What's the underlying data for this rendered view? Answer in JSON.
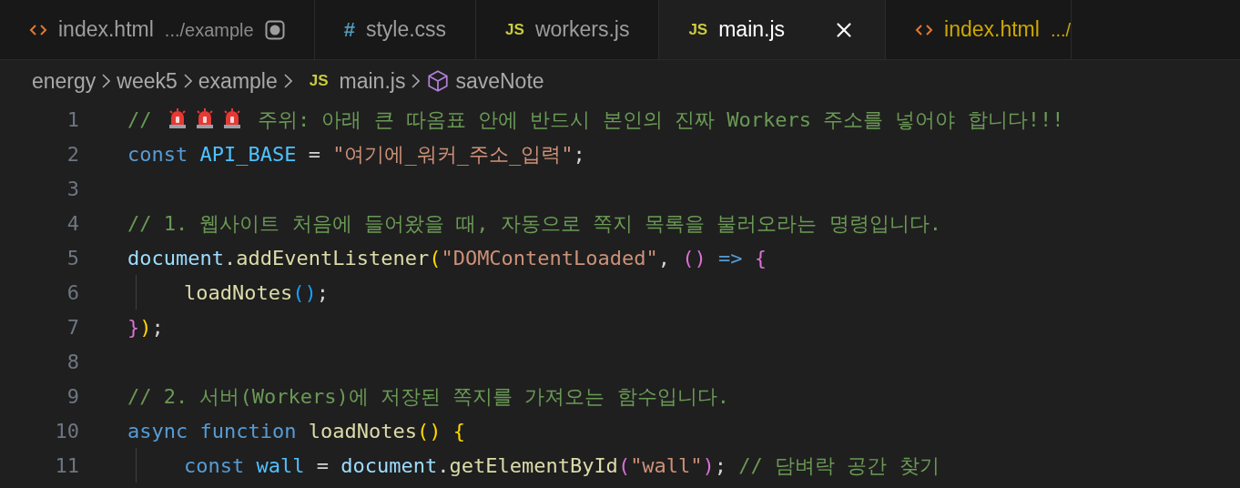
{
  "tabs": [
    {
      "icon": {
        "kind": "html"
      },
      "label": "index.html",
      "path": ".../example",
      "selected": false,
      "dirty": true,
      "warning": false
    },
    {
      "icon": {
        "kind": "css",
        "glyph": "#"
      },
      "label": "style.css",
      "selected": false,
      "dirty": false,
      "warning": false
    },
    {
      "icon": {
        "kind": "js",
        "glyph": "JS"
      },
      "label": "workers.js",
      "selected": false,
      "dirty": false,
      "warning": false
    },
    {
      "icon": {
        "kind": "js",
        "glyph": "JS"
      },
      "label": "main.js",
      "selected": true,
      "dirty": false,
      "warning": false
    },
    {
      "icon": {
        "kind": "html"
      },
      "label": "index.html",
      "path": ".../",
      "selected": false,
      "dirty": false,
      "warning": true
    }
  ],
  "breadcrumb": [
    {
      "kind": "folder",
      "label": "energy"
    },
    {
      "kind": "folder",
      "label": "week5"
    },
    {
      "kind": "folder",
      "label": "example"
    },
    {
      "kind": "file",
      "glyph": "JS",
      "label": "main.js"
    },
    {
      "kind": "symbol",
      "label": "saveNote"
    }
  ],
  "lines": [
    {
      "number": "1",
      "indent": false,
      "tokens": [
        {
          "kind": "comment",
          "text": "// "
        },
        {
          "kind": "siren"
        },
        {
          "kind": "siren"
        },
        {
          "kind": "siren"
        },
        {
          "kind": "comment",
          "text": " 주위: 아래 큰 따옴표 안에 반드시 본인의 진짜 Workers 주소를 넣어야 합니다!!!"
        }
      ]
    },
    {
      "number": "2",
      "indent": false,
      "tokens": [
        {
          "kind": "keyword",
          "text": "const "
        },
        {
          "kind": "constant",
          "text": "API_BASE"
        },
        {
          "kind": "plain",
          "text": " = "
        },
        {
          "kind": "string",
          "text": "\"여기에_워커_주소_입력\""
        },
        {
          "kind": "plain",
          "text": ";"
        }
      ]
    },
    {
      "number": "3",
      "indent": false
    },
    {
      "number": "4",
      "indent": false,
      "tokens": [
        {
          "kind": "comment",
          "text": "// 1. 웹사이트 처음에 들어왔을 때, 자동으로 쪽지 목록을 불러오라는 명령입니다."
        }
      ]
    },
    {
      "number": "5",
      "indent": false,
      "tokens": [
        {
          "kind": "variable",
          "text": "document"
        },
        {
          "kind": "plain",
          "text": "."
        },
        {
          "kind": "function",
          "text": "addEventListener"
        },
        {
          "kind": "bracket1",
          "text": "("
        },
        {
          "kind": "string",
          "text": "\"DOMContentLoaded\""
        },
        {
          "kind": "plain",
          "text": ", "
        },
        {
          "kind": "bracket2",
          "text": "() "
        },
        {
          "kind": "keyword",
          "text": "=> "
        },
        {
          "kind": "bracket2",
          "text": "{"
        }
      ]
    },
    {
      "number": "6",
      "indent": true,
      "tokens": [
        {
          "kind": "function",
          "text": "loadNotes"
        },
        {
          "kind": "bracket3",
          "text": "()"
        },
        {
          "kind": "plain",
          "text": ";"
        }
      ]
    },
    {
      "number": "7",
      "indent": false,
      "tokens": [
        {
          "kind": "bracket2",
          "text": "}"
        },
        {
          "kind": "bracket1",
          "text": ")"
        },
        {
          "kind": "plain",
          "text": ";"
        }
      ]
    },
    {
      "number": "8",
      "indent": false
    },
    {
      "number": "9",
      "indent": false,
      "tokens": [
        {
          "kind": "comment",
          "text": "// 2. 서버(Workers)에 저장된 쪽지를 가져오는 함수입니다."
        }
      ]
    },
    {
      "number": "10",
      "indent": false,
      "tokens": [
        {
          "kind": "keyword",
          "text": "async function "
        },
        {
          "kind": "function",
          "text": "loadNotes"
        },
        {
          "kind": "bracket1",
          "text": "() {"
        }
      ]
    },
    {
      "number": "11",
      "indent": true,
      "tokens": [
        {
          "kind": "keyword",
          "text": "const "
        },
        {
          "kind": "constant",
          "text": "wall"
        },
        {
          "kind": "plain",
          "text": " = "
        },
        {
          "kind": "variable",
          "text": "document"
        },
        {
          "kind": "plain",
          "text": "."
        },
        {
          "kind": "function",
          "text": "getElementById"
        },
        {
          "kind": "bracket2",
          "text": "("
        },
        {
          "kind": "string",
          "text": "\"wall\""
        },
        {
          "kind": "bracket2",
          "text": ")"
        },
        {
          "kind": "plain",
          "text": "; "
        },
        {
          "kind": "comment",
          "text": "// 담벼락 공간 찾기"
        }
      ]
    }
  ]
}
